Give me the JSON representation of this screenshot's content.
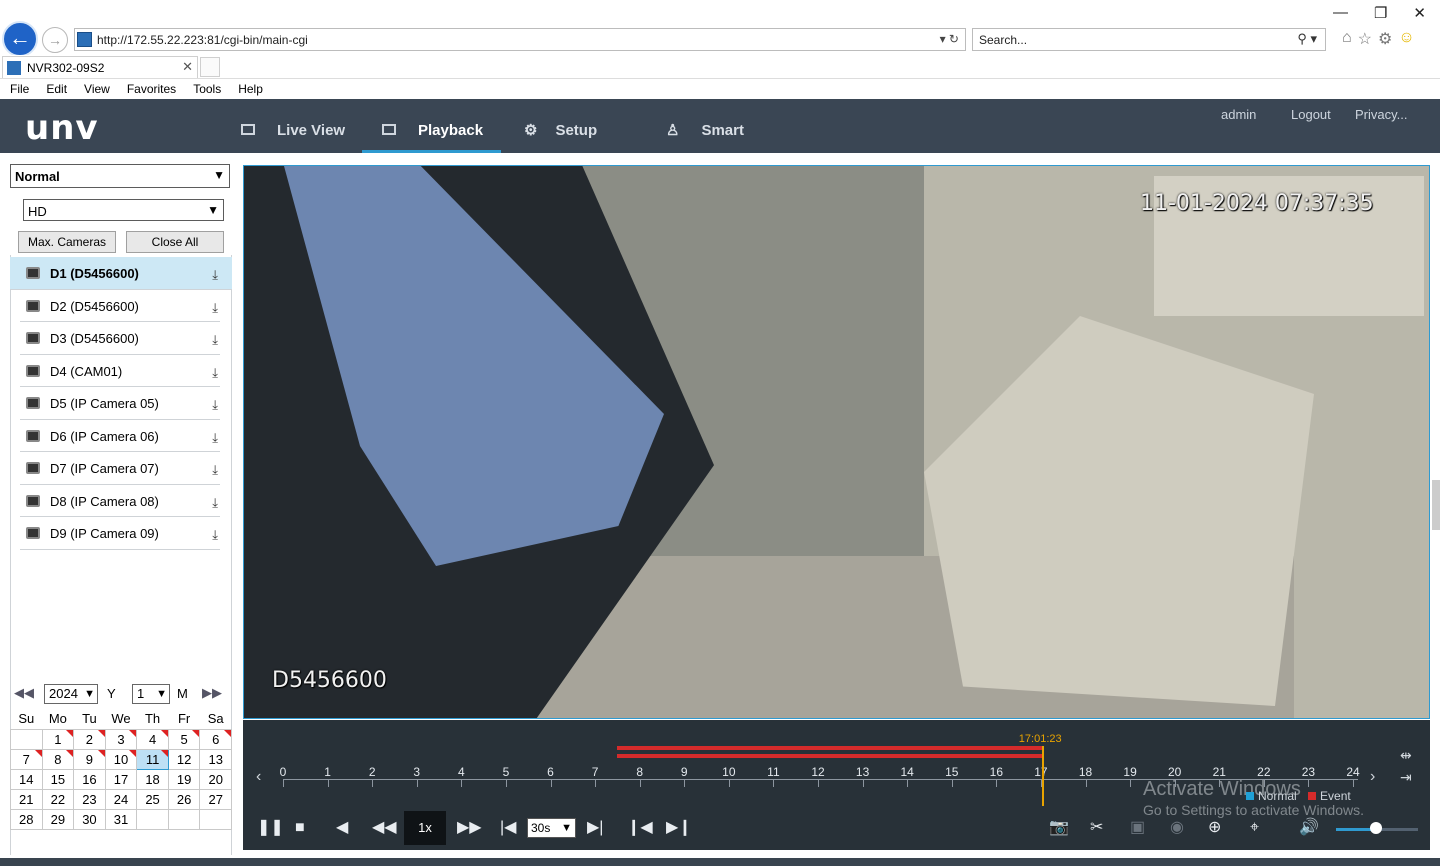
{
  "browser": {
    "url": "http://172.55.22.223:81/cgi-bin/main-cgi",
    "search_placeholder": "Search...",
    "tab_title": "NVR302-09S2",
    "menu": [
      "File",
      "Edit",
      "View",
      "Favorites",
      "Tools",
      "Help"
    ]
  },
  "header": {
    "logo": "unv",
    "nav": [
      "Live View",
      "Playback",
      "Setup",
      "Smart"
    ],
    "active_nav": "Playback",
    "user": "admin",
    "logout": "Logout",
    "privacy": "Privacy..."
  },
  "left": {
    "mode": "Normal",
    "stream": "HD",
    "max_cameras": "Max. Cameras",
    "close_all": "Close All",
    "cameras": [
      "D1 (D5456600)",
      "D2 (D5456600)",
      "D3 (D5456600)",
      "D4 (CAM01)",
      "D5 (IP Camera 05)",
      "D6 (IP Camera 06)",
      "D7 (IP Camera 07)",
      "D8 (IP Camera 08)",
      "D9 (IP Camera 09)"
    ],
    "selected_camera_index": 0
  },
  "calendar": {
    "year": "2024",
    "year_label": "Y",
    "month": "1",
    "month_label": "M",
    "weekdays": [
      "Su",
      "Mo",
      "Tu",
      "We",
      "Th",
      "Fr",
      "Sa"
    ],
    "weeks": [
      [
        "",
        "1",
        "2",
        "3",
        "4",
        "5",
        "6"
      ],
      [
        "7",
        "8",
        "9",
        "10",
        "11",
        "12",
        "13"
      ],
      [
        "14",
        "15",
        "16",
        "17",
        "18",
        "19",
        "20"
      ],
      [
        "21",
        "22",
        "23",
        "24",
        "25",
        "26",
        "27"
      ],
      [
        "28",
        "29",
        "30",
        "31",
        "",
        "",
        ""
      ]
    ],
    "recorded_days": [
      "1",
      "2",
      "3",
      "4",
      "5",
      "6",
      "7",
      "8",
      "9",
      "10",
      "11"
    ],
    "selected_day": "11"
  },
  "video": {
    "osd_datetime": "11-01-2024 07:37:35",
    "osd_camera": "D5456600"
  },
  "timeline": {
    "current_time": "17:01:23",
    "current_hour": 17.02,
    "hours": [
      "0",
      "1",
      "2",
      "3",
      "4",
      "5",
      "6",
      "7",
      "8",
      "9",
      "10",
      "11",
      "12",
      "13",
      "14",
      "15",
      "16",
      "17",
      "18",
      "19",
      "20",
      "21",
      "22",
      "23",
      "24"
    ],
    "record_start_hour": 7.5,
    "record_end_hour": 17.02,
    "legend_normal": "Normal",
    "legend_event": "Event",
    "normal_color": "#1fa0d6",
    "event_color": "#d52b2b"
  },
  "playback": {
    "speed": "1x",
    "step": "30s"
  },
  "watermark": {
    "line1": "Activate Windows",
    "line2": "Go to Settings to activate Windows."
  }
}
